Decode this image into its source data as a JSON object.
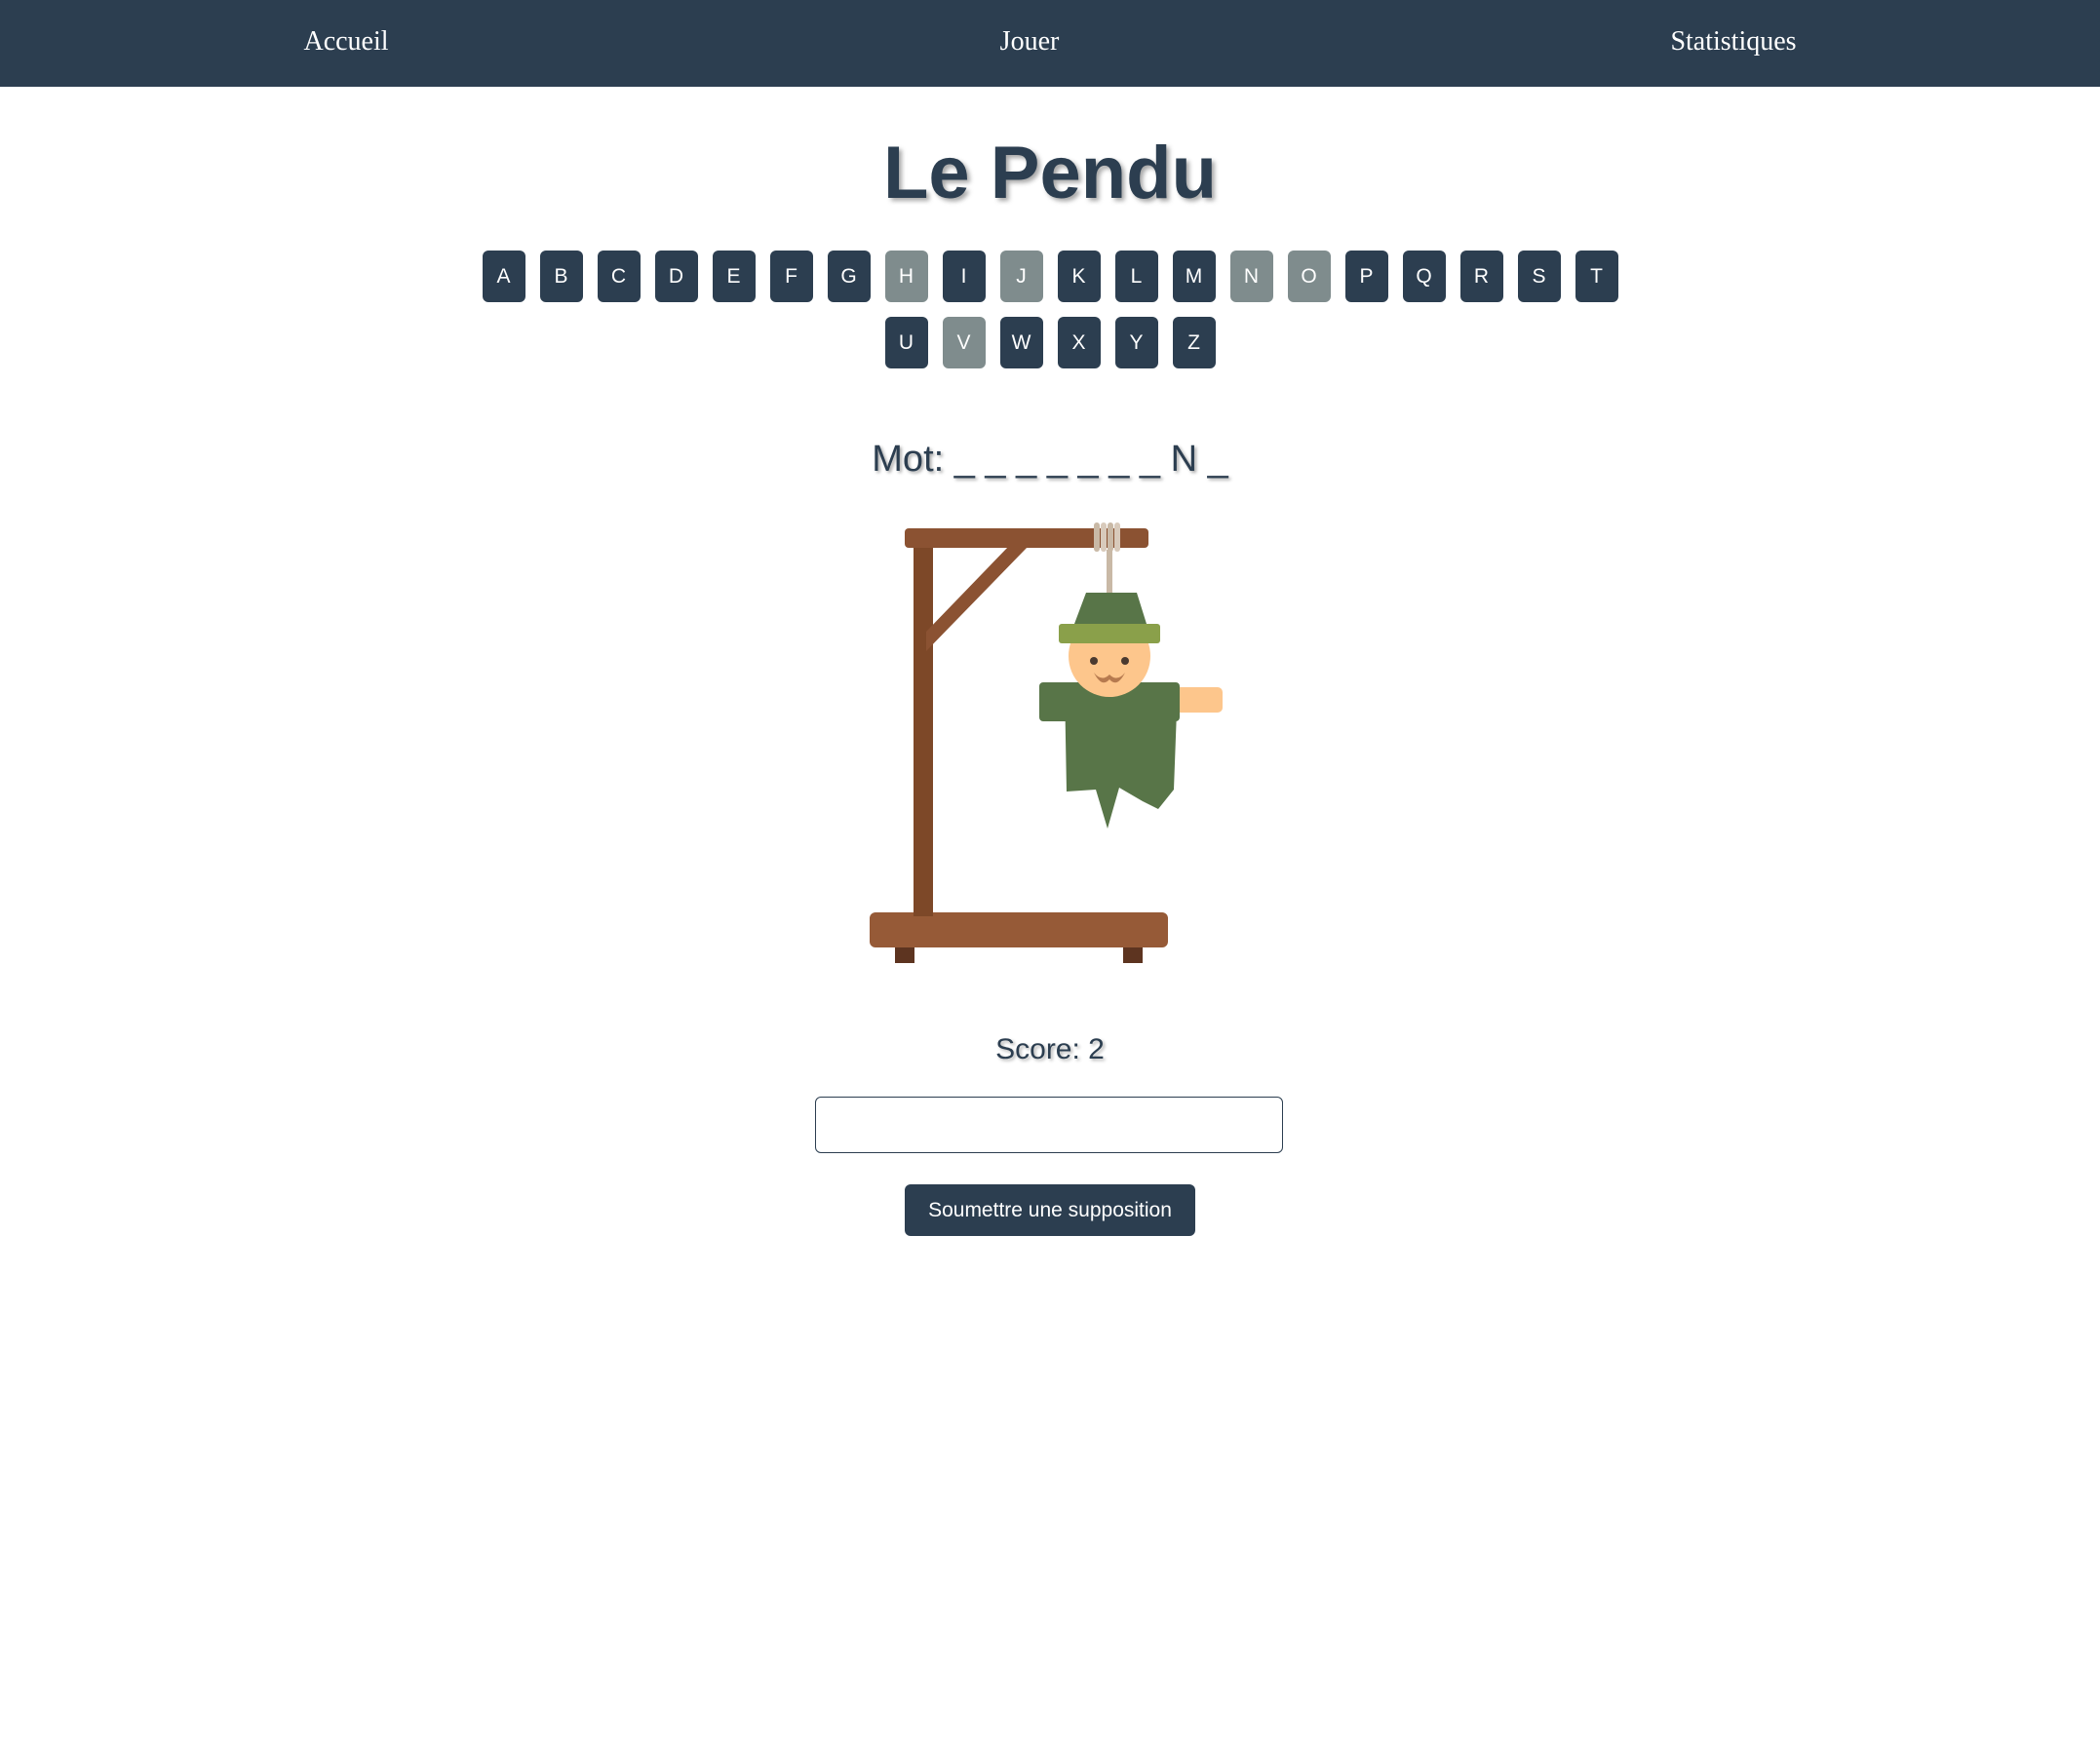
{
  "nav": {
    "items": [
      {
        "label": "Accueil"
      },
      {
        "label": "Jouer"
      },
      {
        "label": "Statistiques"
      }
    ]
  },
  "game": {
    "title": "Le Pendu",
    "keyboard_rows": [
      [
        {
          "letter": "A",
          "used": false
        },
        {
          "letter": "B",
          "used": false
        },
        {
          "letter": "C",
          "used": false
        },
        {
          "letter": "D",
          "used": false
        },
        {
          "letter": "E",
          "used": false
        },
        {
          "letter": "F",
          "used": false
        },
        {
          "letter": "G",
          "used": false
        },
        {
          "letter": "H",
          "used": true
        },
        {
          "letter": "I",
          "used": false
        },
        {
          "letter": "J",
          "used": true
        },
        {
          "letter": "K",
          "used": false
        },
        {
          "letter": "L",
          "used": false
        },
        {
          "letter": "M",
          "used": false
        },
        {
          "letter": "N",
          "used": true
        },
        {
          "letter": "O",
          "used": true
        },
        {
          "letter": "P",
          "used": false
        },
        {
          "letter": "Q",
          "used": false
        },
        {
          "letter": "R",
          "used": false
        },
        {
          "letter": "S",
          "used": false
        },
        {
          "letter": "T",
          "used": false
        }
      ],
      [
        {
          "letter": "U",
          "used": false
        },
        {
          "letter": "V",
          "used": true
        },
        {
          "letter": "W",
          "used": false
        },
        {
          "letter": "X",
          "used": false
        },
        {
          "letter": "Y",
          "used": false
        },
        {
          "letter": "Z",
          "used": false
        }
      ]
    ],
    "word_display": "Mot: _ _ _ _ _ _ _ N _",
    "score_text": "Score: 2",
    "guess_input_value": "",
    "submit_label": "Soumettre une supposition"
  },
  "colors": {
    "primary": "#2c3e50",
    "key_used": "#7f8c8d",
    "wood": "#8b5232",
    "wood_dark": "#5d3420",
    "coat": "#587548",
    "hat_band": "#8aa04a",
    "skin": "#fdc68c",
    "rope": "#c9b9a6"
  },
  "icons": {
    "illustration": "hangman-gallows-figure"
  }
}
